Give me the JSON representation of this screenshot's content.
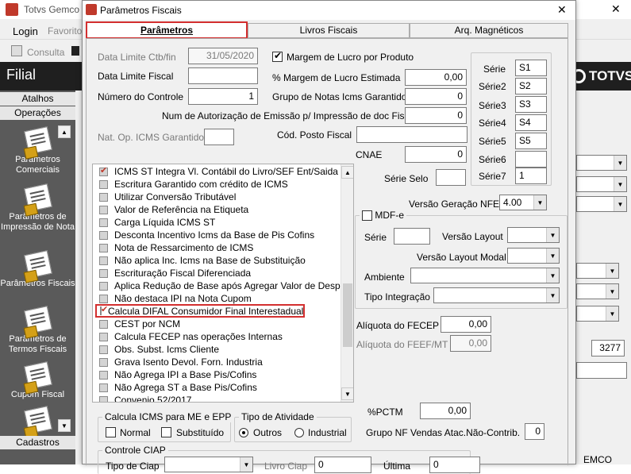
{
  "main_window": {
    "title": "Totvs Gemco",
    "menu_login": "Login",
    "menu_favorites": "Favorito",
    "toolbar_consulta": "Consulta",
    "page_header": "Filial",
    "brand": "TOTVS"
  },
  "sidebar": {
    "atalhos": "Atalhos",
    "operacoes": "Operações",
    "items": [
      {
        "label": "Parâmetros Comerciais",
        "icon": "document-pencil-icon"
      },
      {
        "label": "Parâmetros de Impressão de Nota",
        "icon": "document-pencil-icon"
      },
      {
        "label": "Parâmetros Fiscais",
        "icon": "document-pencil-icon"
      },
      {
        "label": "Parâmetros de Termos Fiscais",
        "icon": "document-pencil-icon"
      },
      {
        "label": "Cupom Fiscal",
        "icon": "document-pencil-icon"
      }
    ],
    "cadastros": "Cadastros"
  },
  "bg_fields": {
    "value_3277": "3277",
    "footer_text": "EMCO"
  },
  "dialog": {
    "title": "Parâmetros Fiscais",
    "close_glyph": "✕",
    "tabs": [
      {
        "label": "Parâmetros",
        "active": true
      },
      {
        "label": "Livros Fiscais",
        "active": false
      },
      {
        "label": "Arq. Magnéticos",
        "active": false
      }
    ],
    "fields": {
      "data_limite_ctb_label": "Data Limite Ctb/fin",
      "data_limite_ctb_value": "31/05/2020",
      "data_limite_fiscal_label": "Data Limite Fiscal",
      "data_limite_fiscal_value": "",
      "numero_controle_label": "Número do Controle",
      "numero_controle_value": "1",
      "margem_lucro_produto_label": "Margem de Lucro por Produto",
      "margem_lucro_produto_checked": true,
      "margem_lucro_estimada_label": "% Margem de Lucro Estimada",
      "margem_lucro_estimada_value": "0,00",
      "grupo_notas_label": "Grupo de Notas Icms Garantido",
      "grupo_notas_value": "0",
      "num_autorizacao_label": "Num de Autorização de Emissão p/ Impressão de doc Fiscais",
      "num_autorizacao_value": "0",
      "nat_op_label": "Nat. Op. ICMS Garantido",
      "nat_op_value": "",
      "cod_posto_label": "Cód. Posto Fiscal",
      "cod_posto_value": "",
      "cnae_label": "CNAE",
      "cnae_value": "0",
      "serie_selo_label": "Série Selo",
      "serie_selo_value": "",
      "versao_nfe_label": "Versão Geração NFE",
      "versao_nfe_value": "4.00"
    },
    "series": [
      {
        "label": "Série",
        "value": "S1"
      },
      {
        "label": "Série2",
        "value": "S2"
      },
      {
        "label": "Série3",
        "value": "S3"
      },
      {
        "label": "Série4",
        "value": "S4"
      },
      {
        "label": "Série5",
        "value": "S5"
      },
      {
        "label": "Série6",
        "value": ""
      },
      {
        "label": "Série7",
        "value": "1"
      }
    ],
    "checklist": [
      {
        "label": "ICMS ST Integra Vl. Contábil do Livro/SEF Ent/Saida",
        "checked": true
      },
      {
        "label": "Escritura Garantido com crédito de ICMS",
        "checked": false
      },
      {
        "label": "Utilizar Conversão Tributável",
        "checked": false
      },
      {
        "label": "Valor de Referência na Etiqueta",
        "checked": false
      },
      {
        "label": "Carga Líquida ICMS ST",
        "checked": false
      },
      {
        "label": "Desconta Incentivo Icms da Base de Pis Cofins",
        "checked": false
      },
      {
        "label": "Nota de Ressarcimento de ICMS",
        "checked": false
      },
      {
        "label": "Não aplica Inc. Icms na Base de Substituição",
        "checked": false
      },
      {
        "label": "Escrituração Fiscal Diferenciada",
        "checked": false
      },
      {
        "label": "Aplica Redução de Base após Agregar Valor de Despesas",
        "checked": false
      },
      {
        "label": "Não destaca IPI na Nota Cupom",
        "checked": false
      },
      {
        "label": "Calcula DIFAL Consumidor Final Interestadual",
        "checked": true
      },
      {
        "label": "CEST por NCM",
        "checked": false
      },
      {
        "label": "Calcula FECEP nas operações Internas",
        "checked": false
      },
      {
        "label": "Obs. Subst. Icms Cliente",
        "checked": false
      },
      {
        "label": "Grava Isento Devol. Forn. Industria",
        "checked": false
      },
      {
        "label": "Não Agrega IPI a Base Pis/Cofins",
        "checked": false
      },
      {
        "label": "Não Agrega ST a Base Pis/Cofins",
        "checked": false
      },
      {
        "label": "Convenio 52/2017",
        "checked": false
      }
    ],
    "mdfe": {
      "label": "MDF-e",
      "checked": false,
      "serie_label": "Série",
      "serie_value": "",
      "versao_layout_label": "Versão Layout",
      "versao_layout_value": "",
      "versao_layout_modal_label": "Versão Layout Modal",
      "versao_layout_modal_value": "",
      "ambiente_label": "Ambiente",
      "ambiente_value": "",
      "tipo_integracao_label": "Tipo Integração",
      "tipo_integracao_value": ""
    },
    "aliquota_fecep_label": "Alíquota do FECEP",
    "aliquota_fecep_value": "0,00",
    "aliquota_feef_label": "Alíquota do FEEF/MT",
    "aliquota_feef_value": "0,00",
    "pctm_label": "%PCTM",
    "pctm_value": "0,00",
    "grupo_nf_label": "Grupo NF Vendas Atac.Não-Contrib.",
    "grupo_nf_value": "0",
    "calcula_icms_group": {
      "legend": "Calcula ICMS para ME e EPP",
      "normal_label": "Normal",
      "normal_checked": false,
      "substituido_label": "Substituído",
      "substituido_checked": false
    },
    "tipo_atividade_group": {
      "legend": "Tipo de Atividade",
      "outros_label": "Outros",
      "outros_selected": true,
      "industrial_label": "Industrial",
      "industrial_selected": false
    },
    "controle_ciap": {
      "legend": "Controle CIAP",
      "tipo_label": "Tipo de Ciap",
      "livro_label": "Livro Ciap",
      "livro_value": "0",
      "ultima_label": "Última",
      "ultima_value": "0"
    }
  }
}
